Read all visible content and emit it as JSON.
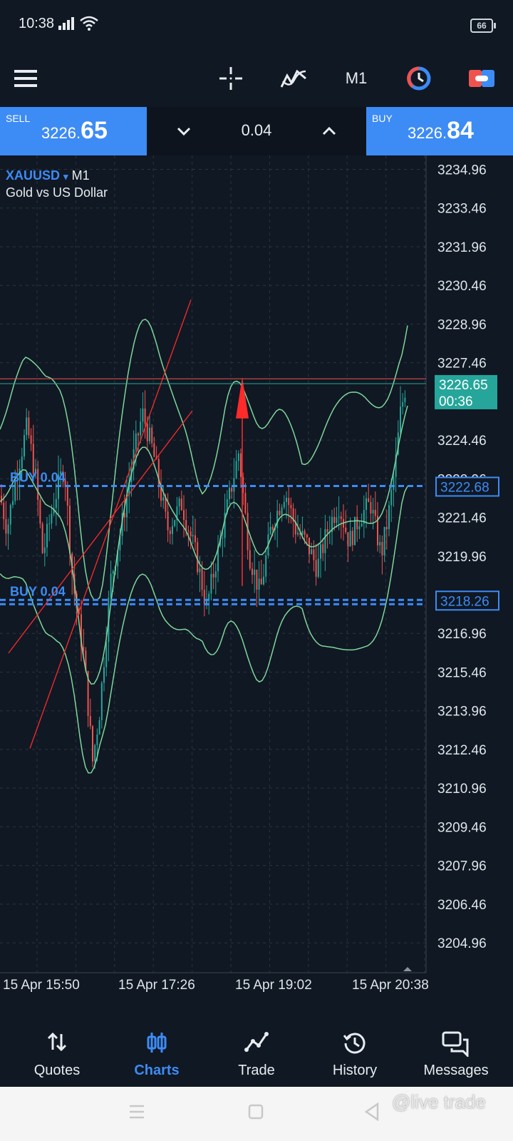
{
  "status": {
    "time": "10:38",
    "battery": "66"
  },
  "toolbar": {
    "timeframe": "M1"
  },
  "trade": {
    "sell_label": "SELL",
    "sell_price_small": "3226.",
    "sell_price_big": "65",
    "buy_label": "BUY",
    "buy_price_small": "3226.",
    "buy_price_big": "84",
    "lot": "0.04"
  },
  "symbol": {
    "name": "XAUUSD",
    "caret": "▾",
    "timeframe": "M1",
    "description": "Gold vs US Dollar"
  },
  "chart_data": {
    "type": "candlestick",
    "y_ticks": [
      "3234.96",
      "3233.46",
      "3231.96",
      "3230.46",
      "3228.96",
      "3227.46",
      "3224.46",
      "3222.96",
      "3221.46",
      "3219.96",
      "3216.96",
      "3215.46",
      "3213.96",
      "3212.46",
      "3210.96",
      "3209.46",
      "3207.96",
      "3206.46",
      "3204.96"
    ],
    "ylim": [
      3203.8,
      3235.5
    ],
    "x_ticks": [
      "15 Apr 15:50",
      "15 Apr 17:26",
      "15 Apr 19:02",
      "15 Apr 20:38"
    ],
    "current_bid": "3226.65",
    "bar_countdown": "00:36",
    "ask_line": 3226.84,
    "orders": [
      {
        "label": "BUY 0.04",
        "price": "3222.68",
        "price_value": 3222.68
      },
      {
        "label": "BUY 0.04",
        "price": "3218.26",
        "price_value": 3218.26
      }
    ],
    "colors": {
      "bull": "#26a69a",
      "bear": "#ef5350",
      "bands": "#7ed69b",
      "order": "#3d8bf5",
      "bid_box": "#26a69a",
      "ask_line": "#ef5350"
    }
  },
  "nav": {
    "items": [
      {
        "label": "Quotes",
        "icon": "quotes-icon"
      },
      {
        "label": "Charts",
        "icon": "charts-icon"
      },
      {
        "label": "Trade",
        "icon": "trade-icon"
      },
      {
        "label": "History",
        "icon": "history-icon"
      },
      {
        "label": "Messages",
        "icon": "messages-icon"
      }
    ],
    "active": "Charts"
  },
  "watermark": "@live trade"
}
